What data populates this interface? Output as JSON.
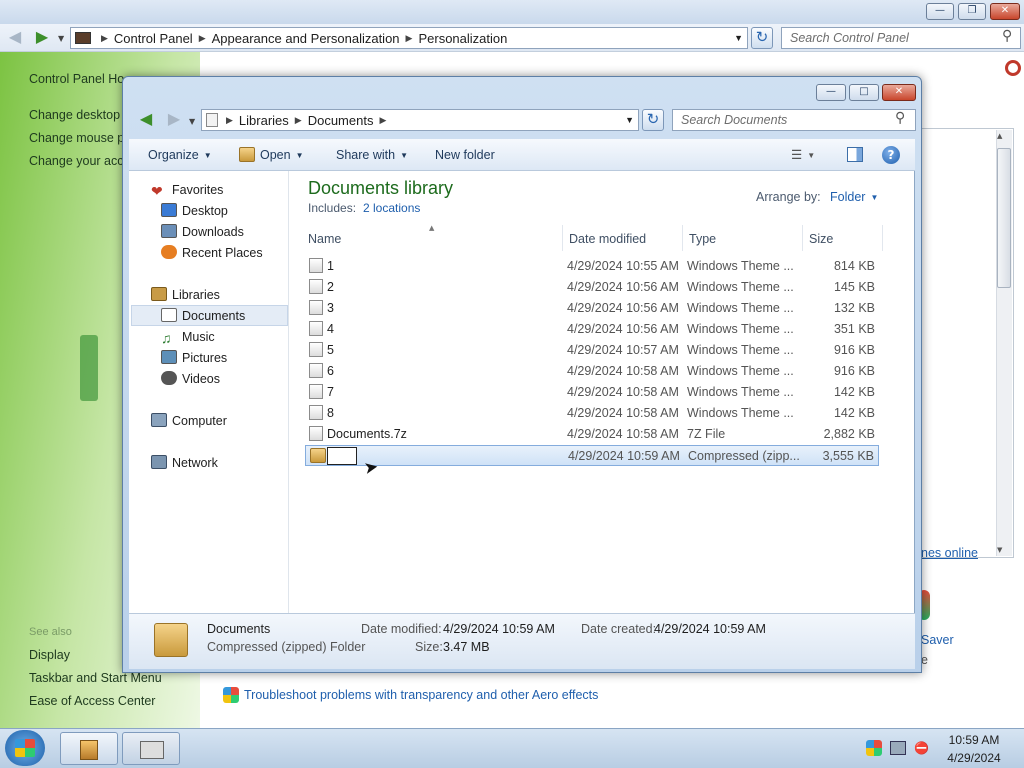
{
  "control_panel": {
    "breadcrumb": [
      "Control Panel",
      "Appearance and Personalization",
      "Personalization"
    ],
    "search_placeholder": "Search Control Panel",
    "sidebar": {
      "home": "Control Panel Ho",
      "links": [
        "Change desktop i",
        "Change mouse po",
        "Change your acco"
      ],
      "see_also": "See also",
      "bottom_links": [
        "Display",
        "Taskbar and Start Menu",
        "Ease of Access Center"
      ]
    },
    "right_pane": {
      "link": "nes online",
      "saver": "Saver",
      "saver_sub": "e"
    },
    "troubleshoot": "Troubleshoot problems with transparency and other Aero effects"
  },
  "explorer": {
    "breadcrumb": [
      "Libraries",
      "Documents"
    ],
    "search_placeholder": "Search Documents",
    "toolbar": {
      "organize": "Organize",
      "open": "Open",
      "share_with": "Share with",
      "new_folder": "New folder"
    },
    "nav": {
      "favorites": "Favorites",
      "desktop": "Desktop",
      "downloads": "Downloads",
      "recent_places": "Recent Places",
      "libraries": "Libraries",
      "documents": "Documents",
      "music": "Music",
      "pictures": "Pictures",
      "videos": "Videos",
      "computer": "Computer",
      "network": "Network"
    },
    "library": {
      "title": "Documents library",
      "includes_label": "Includes:",
      "includes_link": "2 locations",
      "arrange_label": "Arrange by:",
      "arrange_value": "Folder"
    },
    "columns": [
      "Name",
      "Date modified",
      "Type",
      "Size"
    ],
    "files": [
      {
        "name": "1",
        "date": "4/29/2024 10:55 AM",
        "type": "Windows Theme ...",
        "size": "814 KB"
      },
      {
        "name": "2",
        "date": "4/29/2024 10:56 AM",
        "type": "Windows Theme ...",
        "size": "145 KB"
      },
      {
        "name": "3",
        "date": "4/29/2024 10:56 AM",
        "type": "Windows Theme ...",
        "size": "132 KB"
      },
      {
        "name": "4",
        "date": "4/29/2024 10:56 AM",
        "type": "Windows Theme ...",
        "size": "351 KB"
      },
      {
        "name": "5",
        "date": "4/29/2024 10:57 AM",
        "type": "Windows Theme ...",
        "size": "916 KB"
      },
      {
        "name": "6",
        "date": "4/29/2024 10:58 AM",
        "type": "Windows Theme ...",
        "size": "916 KB"
      },
      {
        "name": "7",
        "date": "4/29/2024 10:58 AM",
        "type": "Windows Theme ...",
        "size": "142 KB"
      },
      {
        "name": "8",
        "date": "4/29/2024 10:58 AM",
        "type": "Windows Theme ...",
        "size": "142 KB"
      },
      {
        "name": "Documents.7z",
        "date": "4/29/2024 10:58 AM",
        "type": "7Z File",
        "size": "2,882 KB"
      }
    ],
    "selected_file": {
      "name_edit": "",
      "date": "4/29/2024 10:59 AM",
      "type": "Compressed (zipp...",
      "size": "3,555 KB"
    },
    "details": {
      "name": "Documents",
      "type": "Compressed (zipped) Folder",
      "modified_label": "Date modified:",
      "modified_value": "4/29/2024 10:59 AM",
      "created_label": "Date created:",
      "created_value": "4/29/2024 10:59 AM",
      "size_label": "Size:",
      "size_value": "3.47 MB"
    }
  },
  "taskbar": {
    "time": "10:59 AM",
    "date": "4/29/2024"
  },
  "colors": {
    "accent_green": "#1d6b1d",
    "link_blue": "#1f5fad",
    "selection": "#cfe2f7"
  }
}
